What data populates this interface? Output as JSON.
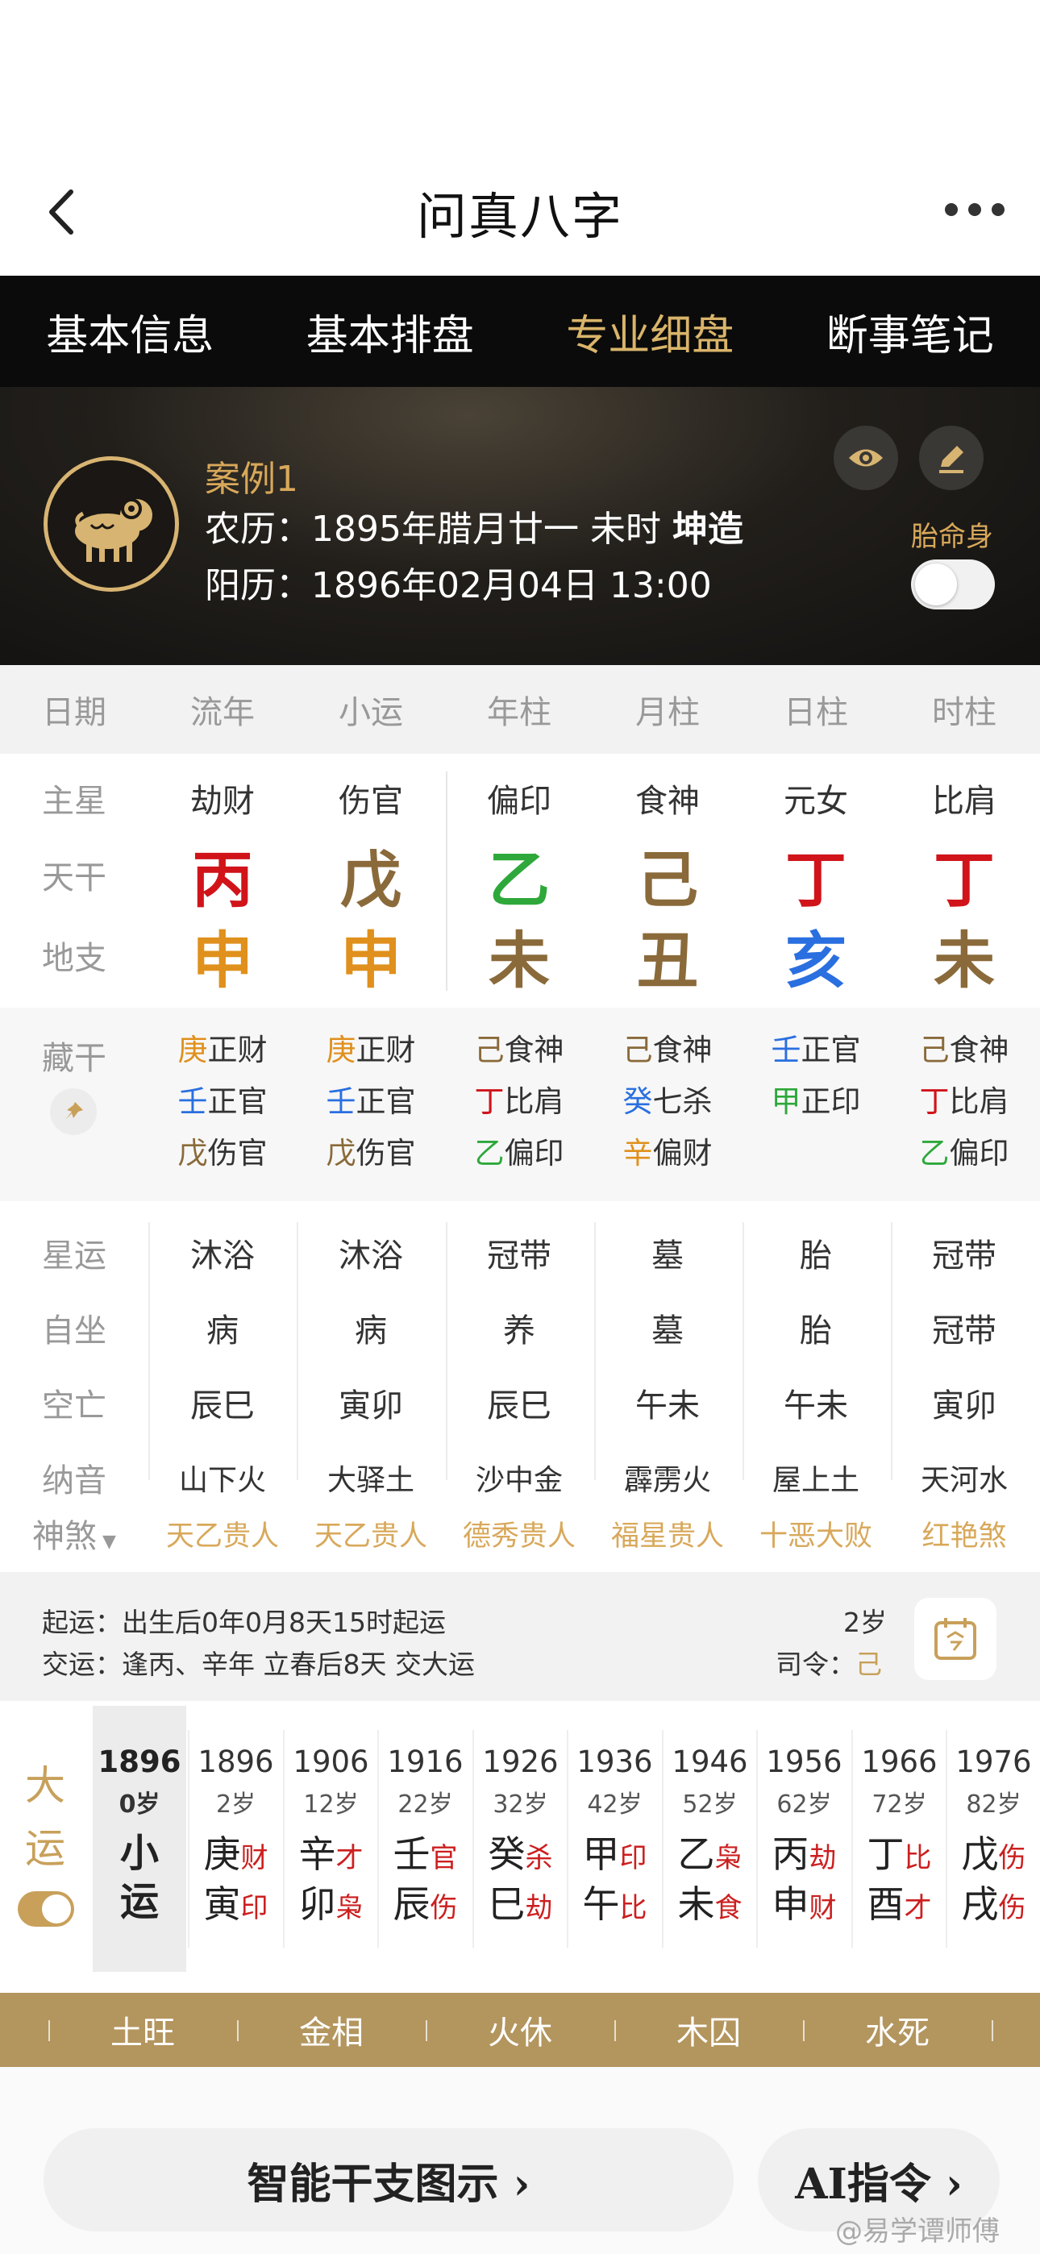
{
  "app": {
    "title": "问真八字"
  },
  "tabs": [
    "基本信息",
    "基本排盘",
    "专业细盘",
    "断事笔记"
  ],
  "profile": {
    "case_name": "案例1",
    "lunar_prefix": "农历：",
    "lunar_date": "1895年腊月廿一 未时 ",
    "gender": "坤造",
    "solar_prefix": "阳历：",
    "solar_date": "1896年02月04日 13:00",
    "taiming_label": "胎命身"
  },
  "header_row": [
    "日期",
    "流年",
    "小运",
    "年柱",
    "月柱",
    "日柱",
    "时柱"
  ],
  "row_labels": {
    "zhuxing": "主星",
    "tiangan": "天干",
    "dizhi": "地支",
    "canggan": "藏干"
  },
  "pillars": [
    {
      "zhuxing": "劫财",
      "gan": "丙",
      "gan_color": "#d0141a",
      "zhi": "申",
      "zhi_color": "#e0901c"
    },
    {
      "zhuxing": "伤官",
      "gan": "戊",
      "gan_color": "#8a6a3a",
      "zhi": "申",
      "zhi_color": "#e0901c"
    },
    {
      "zhuxing": "偏印",
      "gan": "乙",
      "gan_color": "#2ea83a",
      "zhi": "未",
      "zhi_color": "#8a6a3a"
    },
    {
      "zhuxing": "食神",
      "gan": "己",
      "gan_color": "#8a6a3a",
      "zhi": "丑",
      "zhi_color": "#8a6a3a"
    },
    {
      "zhuxing": "元女",
      "gan": "丁",
      "gan_color": "#d0141a",
      "zhi": "亥",
      "zhi_color": "#2a6fe0"
    },
    {
      "zhuxing": "比肩",
      "gan": "丁",
      "gan_color": "#d0141a",
      "zhi": "未",
      "zhi_color": "#8a6a3a"
    }
  ],
  "canggan": [
    [
      {
        "g": "庚",
        "c": "#e0901c",
        "s": "正财"
      },
      {
        "g": "壬",
        "c": "#2a6fe0",
        "s": "正官"
      },
      {
        "g": "戊",
        "c": "#8a6a3a",
        "s": "伤官"
      }
    ],
    [
      {
        "g": "庚",
        "c": "#e0901c",
        "s": "正财"
      },
      {
        "g": "壬",
        "c": "#2a6fe0",
        "s": "正官"
      },
      {
        "g": "戊",
        "c": "#8a6a3a",
        "s": "伤官"
      }
    ],
    [
      {
        "g": "己",
        "c": "#8a6a3a",
        "s": "食神"
      },
      {
        "g": "丁",
        "c": "#d0141a",
        "s": "比肩"
      },
      {
        "g": "乙",
        "c": "#2ea83a",
        "s": "偏印"
      }
    ],
    [
      {
        "g": "己",
        "c": "#8a6a3a",
        "s": "食神"
      },
      {
        "g": "癸",
        "c": "#2a6fe0",
        "s": "七杀"
      },
      {
        "g": "辛",
        "c": "#e0901c",
        "s": "偏财"
      }
    ],
    [
      {
        "g": "壬",
        "c": "#2a6fe0",
        "s": "正官"
      },
      {
        "g": "甲",
        "c": "#2ea83a",
        "s": "正印"
      }
    ],
    [
      {
        "g": "己",
        "c": "#8a6a3a",
        "s": "食神"
      },
      {
        "g": "丁",
        "c": "#d0141a",
        "s": "比肩"
      },
      {
        "g": "乙",
        "c": "#2ea83a",
        "s": "偏印"
      }
    ]
  ],
  "xingyun_rows": [
    {
      "label": "星运",
      "values": [
        "沐浴",
        "沐浴",
        "冠带",
        "墓",
        "胎",
        "冠带"
      ]
    },
    {
      "label": "自坐",
      "values": [
        "病",
        "病",
        "养",
        "墓",
        "胎",
        "冠带"
      ]
    },
    {
      "label": "空亡",
      "values": [
        "辰巳",
        "寅卯",
        "辰巳",
        "午未",
        "午未",
        "寅卯"
      ]
    },
    {
      "label": "纳音",
      "values": [
        "山下火",
        "大驿土",
        "沙中金",
        "霹雳火",
        "屋上土",
        "天河水"
      ]
    }
  ],
  "shensha": {
    "label": "神煞",
    "values": [
      "天乙贵人",
      "天乙贵人",
      "德秀贵人",
      "福星贵人",
      "十恶大败",
      "红艳煞"
    ]
  },
  "qiyun": {
    "line1": "起运：出生后0年0月8天15时起运",
    "line2": "交运：逢丙、辛年 立春后8天 交大运",
    "age": "2岁",
    "siling_label": "司令：",
    "siling_value": "己"
  },
  "dayun": {
    "label_1": "大",
    "label_2": "运",
    "xiaoyun": {
      "year": "1896",
      "age": "0岁",
      "c1": "小",
      "c2": "运"
    },
    "cols": [
      {
        "year": "1896",
        "age": "2岁",
        "g": "庚",
        "gs": "财",
        "z": "寅",
        "zs": "印"
      },
      {
        "year": "1906",
        "age": "12岁",
        "g": "辛",
        "gs": "才",
        "z": "卯",
        "zs": "枭"
      },
      {
        "year": "1916",
        "age": "22岁",
        "g": "壬",
        "gs": "官",
        "z": "辰",
        "zs": "伤"
      },
      {
        "year": "1926",
        "age": "32岁",
        "g": "癸",
        "gs": "杀",
        "z": "巳",
        "zs": "劫"
      },
      {
        "year": "1936",
        "age": "42岁",
        "g": "甲",
        "gs": "印",
        "z": "午",
        "zs": "比"
      },
      {
        "year": "1946",
        "age": "52岁",
        "g": "乙",
        "gs": "枭",
        "z": "未",
        "zs": "食"
      },
      {
        "year": "1956",
        "age": "62岁",
        "g": "丙",
        "gs": "劫",
        "z": "申",
        "zs": "财"
      },
      {
        "year": "1966",
        "age": "72岁",
        "g": "丁",
        "gs": "比",
        "z": "酉",
        "zs": "才"
      },
      {
        "year": "1976",
        "age": "82岁",
        "g": "戊",
        "gs": "伤",
        "z": "戌",
        "zs": "伤"
      }
    ]
  },
  "wuxing": [
    "土旺",
    "金相",
    "火休",
    "木囚",
    "水死"
  ],
  "buttons": {
    "smart": "智能干支图示 ›",
    "ai": "AI指令 ›"
  },
  "watermark": "@易学谭师傅",
  "icons": [
    "back-icon",
    "more-icon",
    "sheep-zodiac-icon",
    "eye-icon",
    "edit-icon",
    "pin-icon",
    "calendar-icon"
  ]
}
